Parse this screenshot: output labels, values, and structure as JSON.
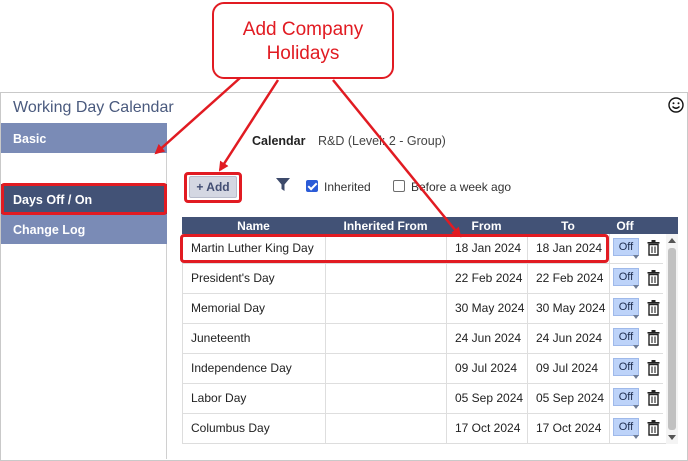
{
  "callout": {
    "text": "Add Company Holidays"
  },
  "app": {
    "title": "Working Day Calendar"
  },
  "sidebar": {
    "items": [
      {
        "label": "Basic",
        "active": false
      },
      {
        "label": "Days Off / On",
        "active": true
      },
      {
        "label": "Change Log",
        "active": false
      }
    ]
  },
  "calendar": {
    "label": "Calendar",
    "value": "R&D (Level: 2 - Group)"
  },
  "toolbar": {
    "add_label": "+ Add",
    "inherited_label": "Inherited",
    "inherited_checked": true,
    "week_label": "Before a week ago",
    "week_checked": false
  },
  "table": {
    "headers": [
      "Name",
      "Inherited From",
      "From",
      "To",
      "Off"
    ],
    "rows": [
      {
        "name": "Martin Luther King Day",
        "inherited_from": "",
        "from": "18 Jan 2024",
        "to": "18 Jan 2024",
        "off": "Off"
      },
      {
        "name": "President's Day",
        "inherited_from": "",
        "from": "22 Feb 2024",
        "to": "22 Feb 2024",
        "off": "Off"
      },
      {
        "name": "Memorial Day",
        "inherited_from": "",
        "from": "30 May 2024",
        "to": "30 May 2024",
        "off": "Off"
      },
      {
        "name": "Juneteenth",
        "inherited_from": "",
        "from": "24 Jun 2024",
        "to": "24 Jun 2024",
        "off": "Off"
      },
      {
        "name": "Independence Day",
        "inherited_from": "",
        "from": "09 Jul 2024",
        "to": "09 Jul 2024",
        "off": "Off"
      },
      {
        "name": "Labor Day",
        "inherited_from": "",
        "from": "05 Sep 2024",
        "to": "05 Sep 2024",
        "off": "Off"
      },
      {
        "name": "Columbus Day",
        "inherited_from": "",
        "from": "17 Oct 2024",
        "to": "17 Oct 2024",
        "off": "Off"
      }
    ]
  },
  "colors": {
    "annotation": "#e11b22",
    "header_bg": "#425276",
    "sidebar_bg": "#7a8bb6",
    "sidebar_active_bg": "#425276",
    "off_button_bg": "#bdd3f9"
  },
  "icons": {
    "filter": "filter-icon",
    "trash": "trash-icon",
    "smiley": "smiley-icon"
  }
}
